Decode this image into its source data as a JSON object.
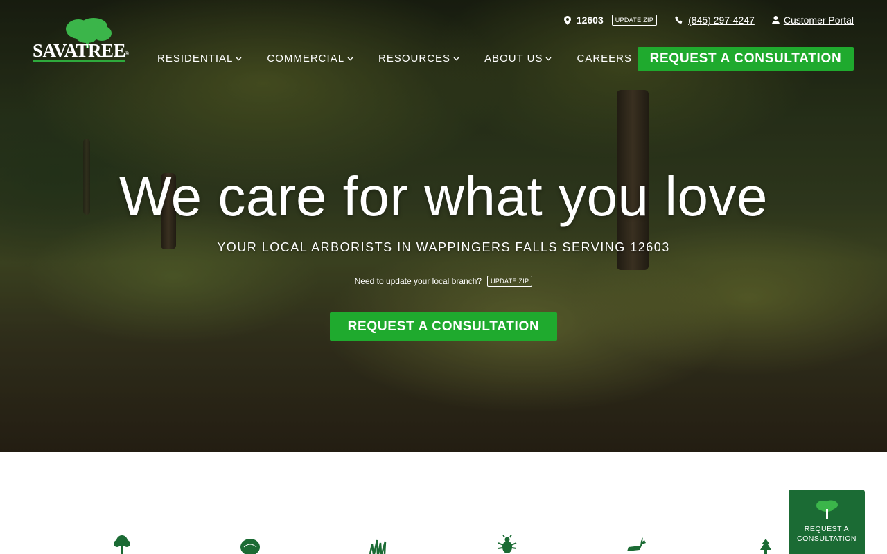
{
  "brand": {
    "name": "SAVATREE",
    "registered": "®",
    "accent": "#1faa2e",
    "dark_green": "#1b6b34"
  },
  "topbar": {
    "zip": "12603",
    "update_zip_label": "UPDATE ZIP",
    "phone": "(845) 297-4247",
    "customer_portal": "Customer Portal"
  },
  "nav": {
    "items": [
      {
        "label": "RESIDENTIAL",
        "has_dropdown": true
      },
      {
        "label": "COMMERCIAL",
        "has_dropdown": true
      },
      {
        "label": "RESOURCES",
        "has_dropdown": true
      },
      {
        "label": "ABOUT US",
        "has_dropdown": true
      },
      {
        "label": "CAREERS",
        "has_dropdown": false
      }
    ],
    "cta_label": "REQUEST A CONSULTATION"
  },
  "hero": {
    "title": "We care for what you love",
    "subtitle": "YOUR LOCAL ARBORISTS IN WAPPINGERS FALLS SERVING 12603",
    "update_prompt": "Need to update your local branch?",
    "update_zip_label": "UPDATE ZIP",
    "cta_label": "REQUEST A CONSULTATION"
  },
  "services_icons": [
    "tree-icon",
    "shrub-icon",
    "grass-icon",
    "insect-icon",
    "deer-icon",
    "evergreen-icon"
  ],
  "floating_cta": {
    "line1": "REQUEST A",
    "line2": "CONSULTATION"
  }
}
